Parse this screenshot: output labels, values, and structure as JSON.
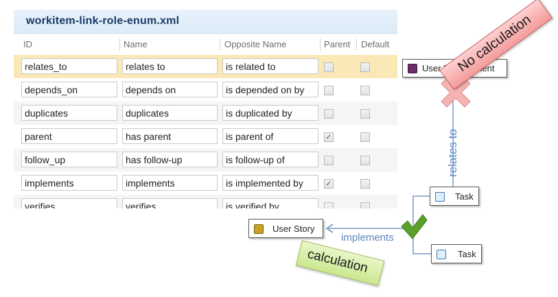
{
  "window": {
    "title": "workitem-link-role-enum.xml"
  },
  "columns": {
    "id": "ID",
    "name": "Name",
    "opposite": "Opposite Name",
    "parent": "Parent",
    "default": "Default"
  },
  "rows": [
    {
      "id": "relates_to",
      "name": "relates to",
      "opposite": "is related to",
      "parent": false,
      "default": false
    },
    {
      "id": "depends_on",
      "name": "depends on",
      "opposite": "is depended on by",
      "parent": false,
      "default": false
    },
    {
      "id": "duplicates",
      "name": "duplicates",
      "opposite": "is duplicated by",
      "parent": false,
      "default": false
    },
    {
      "id": "parent",
      "name": "has parent",
      "opposite": "is parent of",
      "parent": true,
      "default": false
    },
    {
      "id": "follow_up",
      "name": "has follow-up",
      "opposite": "is follow-up of",
      "parent": false,
      "default": false
    },
    {
      "id": "implements",
      "name": "implements",
      "opposite": "is implemented by",
      "parent": true,
      "default": false
    },
    {
      "id": "verifies",
      "name": "verifies",
      "opposite": "is verified by",
      "parent": false,
      "default": false
    }
  ],
  "diagram": {
    "nodes": {
      "user_requirement": "User Requirement",
      "task_top": "Task",
      "task_bottom": "Task",
      "user_story": "User Story"
    },
    "links": {
      "relates_to": "relates to",
      "implements": "implements"
    },
    "banners": {
      "no_calculation": "No calculation",
      "calculation": "calculation"
    }
  },
  "colors": {
    "selected_row": "#fbe8b7",
    "link_blue": "#7a9cc6",
    "check_green": "#5aa12a",
    "cross_red": "#f4a3a3"
  }
}
